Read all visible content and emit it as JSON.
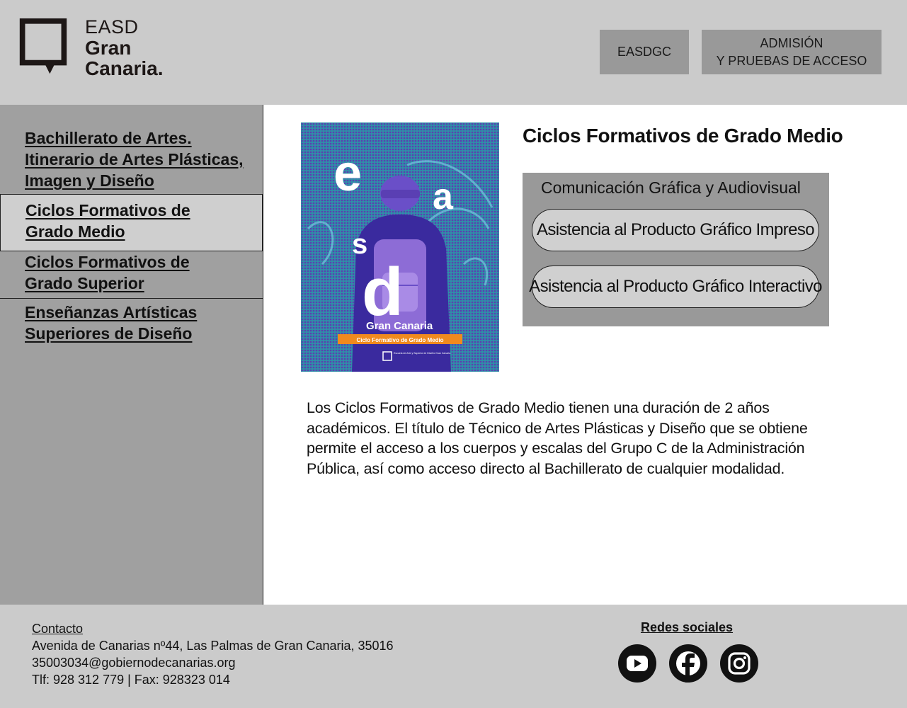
{
  "header": {
    "logo": {
      "line1": "EASD",
      "line2": "Gran",
      "line3": "Canaria."
    },
    "buttons": {
      "easdgc": "EASDGC",
      "admision": "ADMISIÓN\nY PRUEBAS DE ACCESO"
    }
  },
  "sidebar": {
    "items": [
      {
        "label": "Bachillerato de Artes.\nItinerario de Artes Plásticas,\nImagen y Diseño"
      },
      {
        "label": "Ciclos Formativos de\nGrado Medio",
        "active": true
      },
      {
        "label": "Ciclos Formativos de\nGrado Superior"
      },
      {
        "label": "Enseñanzas Artísticas\nSuperiores de Diseño"
      }
    ]
  },
  "main": {
    "title": "Ciclos Formativos de Grado Medio",
    "cover": {
      "letters": [
        "e",
        "a",
        "s",
        "d"
      ],
      "brand": "Gran Canaria",
      "band": "Ciclo Formativo de Grado Medio",
      "school": "Escuela de Arte y Superior de Diseño Gran Canaria"
    },
    "family": {
      "heading": "Comunicación Gráfica y Audiovisual",
      "courses": [
        "Asistencia al Producto Gráfico Impreso",
        "Asistencia al Producto Gráfico Interactivo"
      ]
    },
    "description": "Los Ciclos Formativos de Grado Medio tienen una duración de 2 años académicos. El título de Técnico de Artes Plásticas y Diseño que se obtiene permite el acceso a los cuerpos y escalas del Grupo C de la Administración Pública, así como acceso directo al Bachillerato de cualquier modalidad."
  },
  "footer": {
    "contact": {
      "title": "Contacto",
      "address": "Avenida de Canarias nº44, Las Palmas de Gran Canaria, 35016",
      "email": "35003034@gobiernodecanarias.org",
      "phone": "Tlf: 928 312 779 | Fax: 928323 014"
    },
    "social": {
      "title": "Redes sociales",
      "icons": [
        "youtube-icon",
        "facebook-icon",
        "instagram-icon"
      ]
    }
  },
  "colors": {
    "header_bg": "#cbcbcb",
    "sidebar_bg": "#a0a0a0",
    "active_item_bg": "#cfcfcf",
    "box_bg": "#999999",
    "cover_blue": "#3a58c8",
    "cover_orange": "#f08a1e"
  }
}
